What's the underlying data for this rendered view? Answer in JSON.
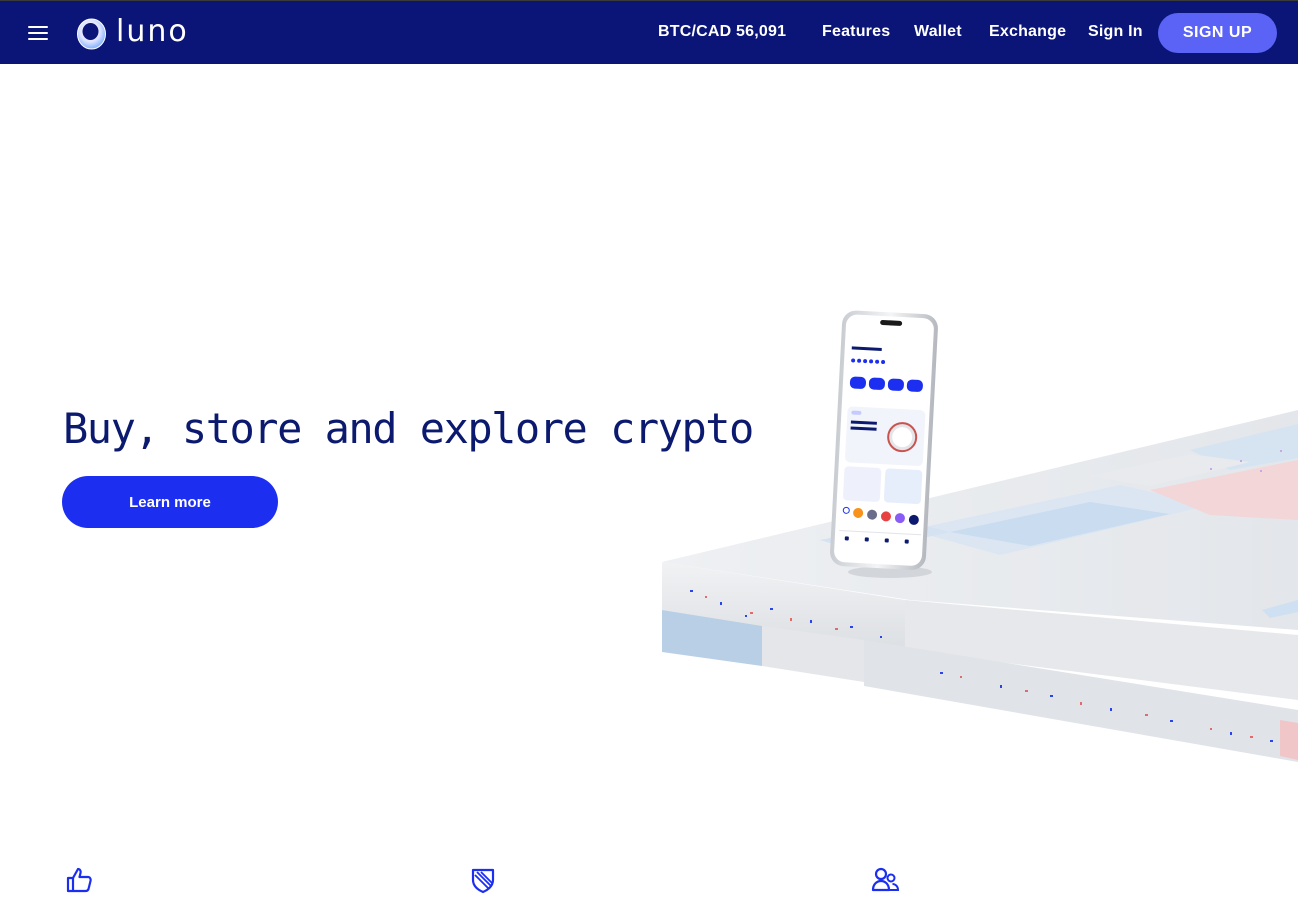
{
  "header": {
    "menu_icon": "hamburger-icon",
    "logo": {
      "text": "luno",
      "icon": "luno-ring-logo"
    },
    "ticker": "BTC/CAD 56,091",
    "nav": {
      "features": "Features",
      "wallet": "Wallet",
      "exchange": "Exchange",
      "signin": "Sign In"
    },
    "signup_label": "SIGN UP"
  },
  "hero": {
    "title": "Buy, store and explore crypto",
    "cta_label": "Learn more",
    "image": "phone-on-terrazzo-platform"
  },
  "features": {
    "icons": [
      "thumbs-up-icon",
      "shield-icon",
      "users-icon"
    ]
  },
  "colors": {
    "header_bg": "#0a1577",
    "signup_bg": "#5b63f7",
    "cta_bg": "#1c2ff0",
    "title": "#0b1a6e",
    "icon": "#1c2ff0"
  }
}
